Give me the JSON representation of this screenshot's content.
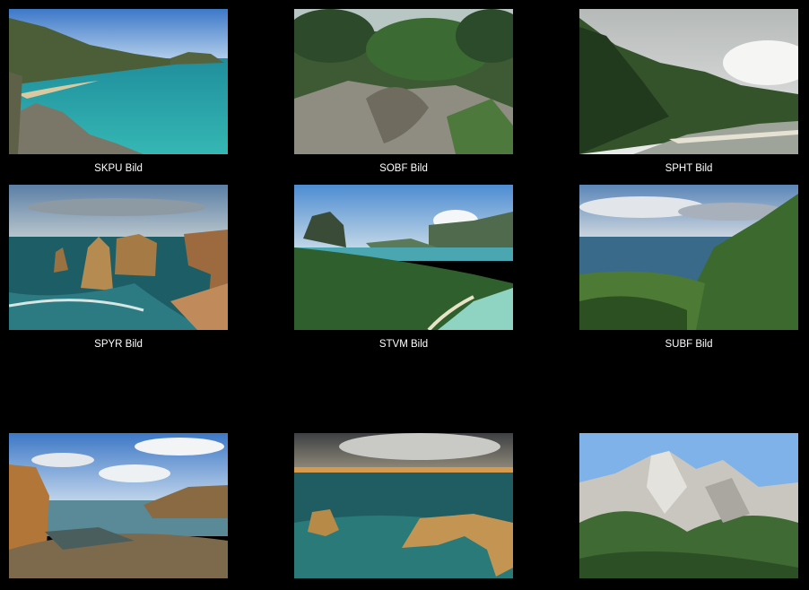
{
  "gallery": {
    "items": [
      {
        "caption": "SKPU Bild"
      },
      {
        "caption": "SOBF Bild"
      },
      {
        "caption": "SPHT Bild"
      },
      {
        "caption": "SPYR Bild"
      },
      {
        "caption": "STVM Bild"
      },
      {
        "caption": "SUBF Bild"
      },
      {
        "caption": ""
      },
      {
        "caption": ""
      },
      {
        "caption": ""
      }
    ]
  }
}
